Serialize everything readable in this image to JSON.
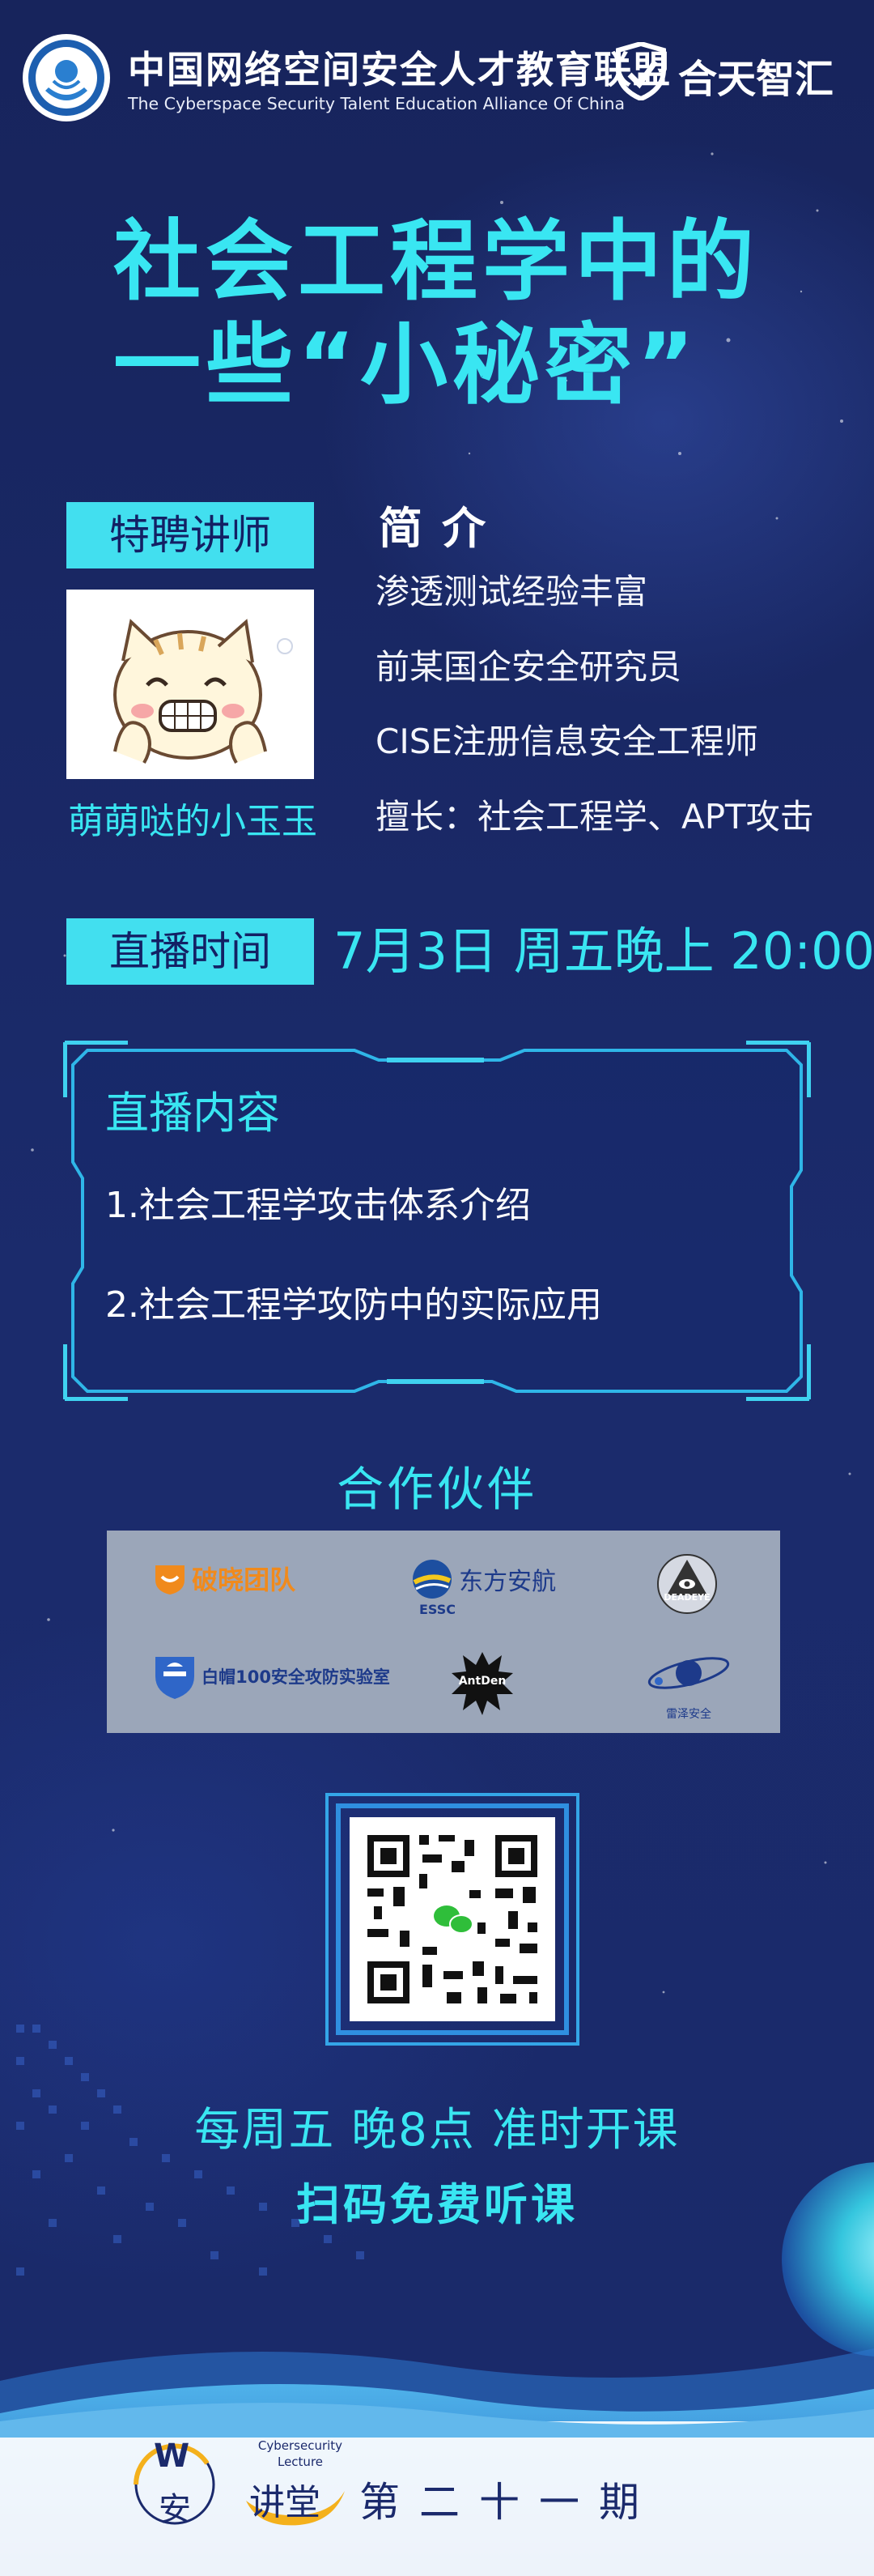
{
  "header": {
    "org_cn": "中国网络空间安全人才教育联盟",
    "org_en": "The Cyberspace Security Talent Education Alliance Of China",
    "brand": "合天智汇"
  },
  "title": {
    "line1": "社会工程学中的",
    "line2": "一些“小秘密”"
  },
  "lecturer": {
    "badge": "特聘讲师",
    "name": "萌萌哒的小玉玉",
    "intro_heading": "简介",
    "intro_lines": [
      "渗透测试经验丰富",
      "前某国企安全研究员",
      "CISE注册信息安全工程师",
      "擅长：社会工程学、APT攻击"
    ]
  },
  "live": {
    "badge": "直播时间",
    "time": "7月3日  周五晚上 20:00"
  },
  "content": {
    "heading": "直播内容",
    "items": [
      "1.社会工程学攻击体系介绍",
      "2.社会工程学攻防中的实际应用"
    ]
  },
  "partners": {
    "heading": "合作伙伴",
    "logos": [
      "破晓团队",
      "东方安航",
      "ESSC",
      "DEADEYE",
      "白帽100安全攻防实验室",
      "AntDen",
      "雷泽安全"
    ]
  },
  "footer": {
    "slogan": "每周五 晚8点 准时开课",
    "scan": "扫码免费听课",
    "logo_letter": "W",
    "logo_char": "安",
    "lecture_en": "Cybersecurity Lecture",
    "lecture_cn": "讲堂",
    "period": "第二十一期"
  },
  "colors": {
    "background": "#17255e",
    "accent": "#39e6f2",
    "badge": "#42dfef",
    "text": "#ffffff"
  }
}
